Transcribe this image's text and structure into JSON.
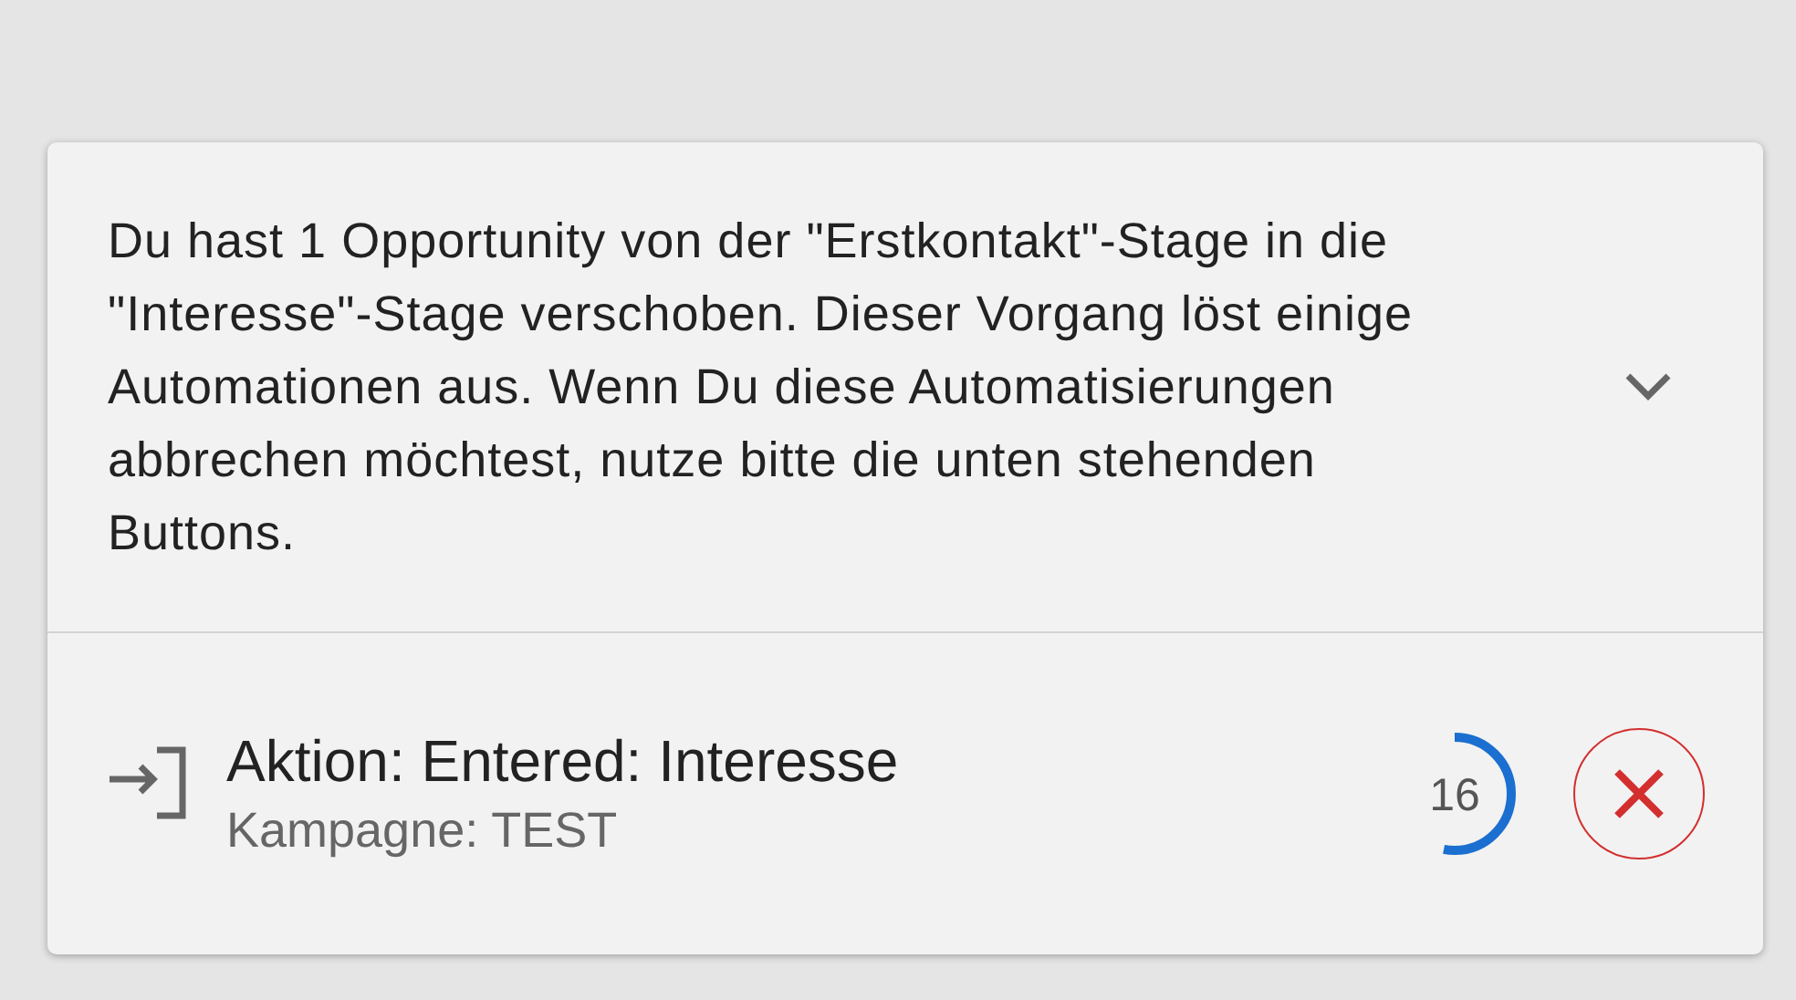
{
  "notice": {
    "message": "Du hast 1 Opportunity von der \"Erstkontakt\"-Stage in die \"Interesse\"-Stage verschoben. Dieser Vorgang löst einige Automationen aus. Wenn Du diese Automatisierungen abbrechen möchtest, nutze bitte die unten stehenden Buttons."
  },
  "actions": [
    {
      "title": "Aktion: Entered: Interesse",
      "subtitle": "Kampagne: TEST",
      "countdown": "16",
      "level": 0.53
    }
  ]
}
